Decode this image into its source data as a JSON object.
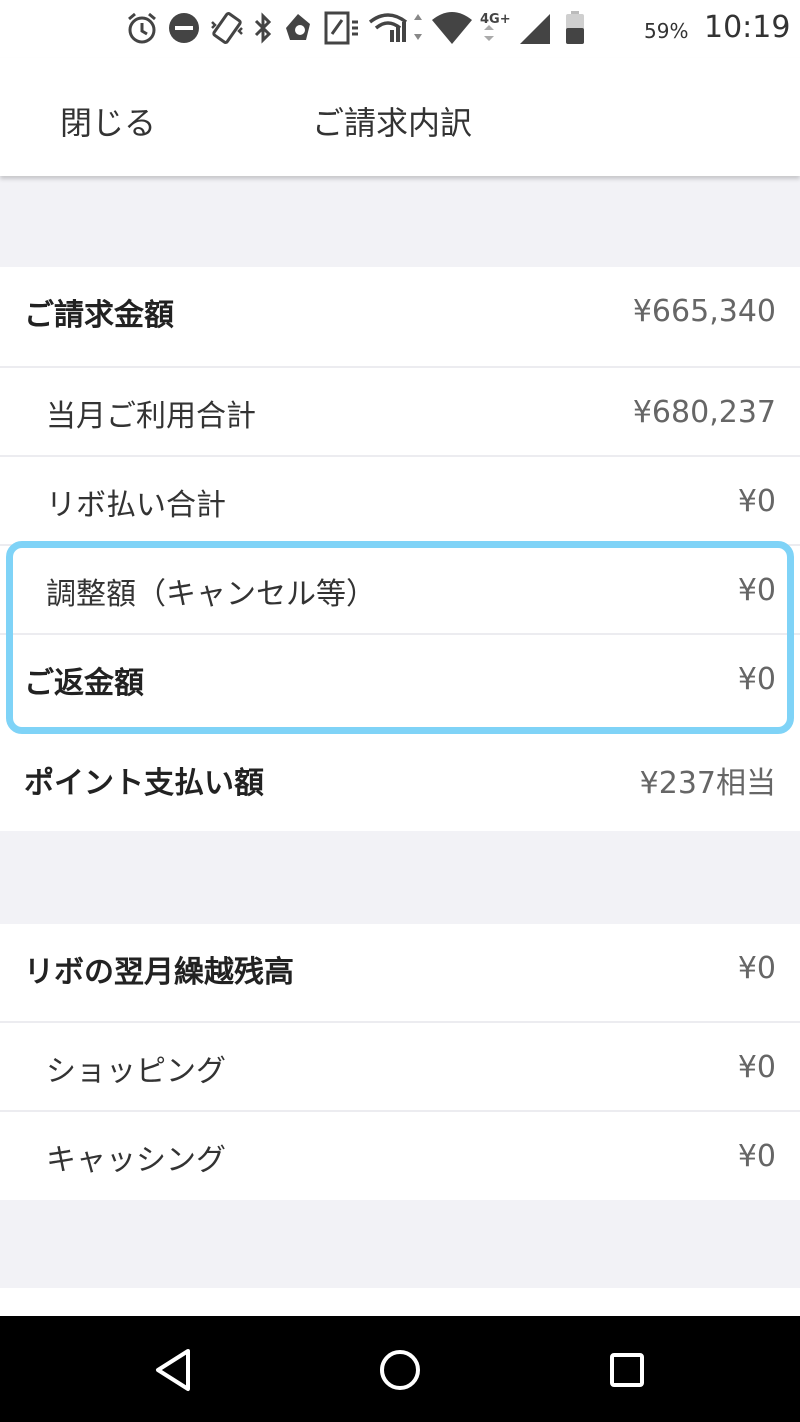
{
  "status_bar": {
    "battery_percent": "59%",
    "time": "10:19",
    "network": "4G+",
    "icons": [
      "alarm-icon",
      "do-not-disturb-icon",
      "vibrate-icon",
      "bluetooth-icon",
      "app-icon",
      "nfc-icon",
      "wifi-calling-icon",
      "wifi-icon",
      "cell-signal-icon",
      "battery-icon"
    ]
  },
  "header": {
    "close_label": "閉じる",
    "title": "ご請求内訳"
  },
  "billing": {
    "total": {
      "label": "ご請求金額",
      "value": "¥665,340"
    },
    "monthly_usage": {
      "label": "当月ご利用合計",
      "value": "¥680,237"
    },
    "revolving_total": {
      "label": "リボ払い合計",
      "value": "¥0"
    },
    "adjustment": {
      "label": "調整額（キャンセル等）",
      "value": "¥0"
    },
    "refund": {
      "label": "ご返金額",
      "value": "¥0"
    },
    "points": {
      "label": "ポイント支払い額",
      "value": "¥237相当"
    }
  },
  "revolving": {
    "balance": {
      "label": "リボの翌月繰越残高",
      "value": "¥0"
    },
    "shopping": {
      "label": "ショッピング",
      "value": "¥0"
    },
    "cashing": {
      "label": "キャッシング",
      "value": "¥0"
    }
  },
  "highlight_color": "#7fd3f7",
  "nav_bar": {
    "icons": [
      "back-icon",
      "home-icon",
      "recents-icon"
    ]
  }
}
